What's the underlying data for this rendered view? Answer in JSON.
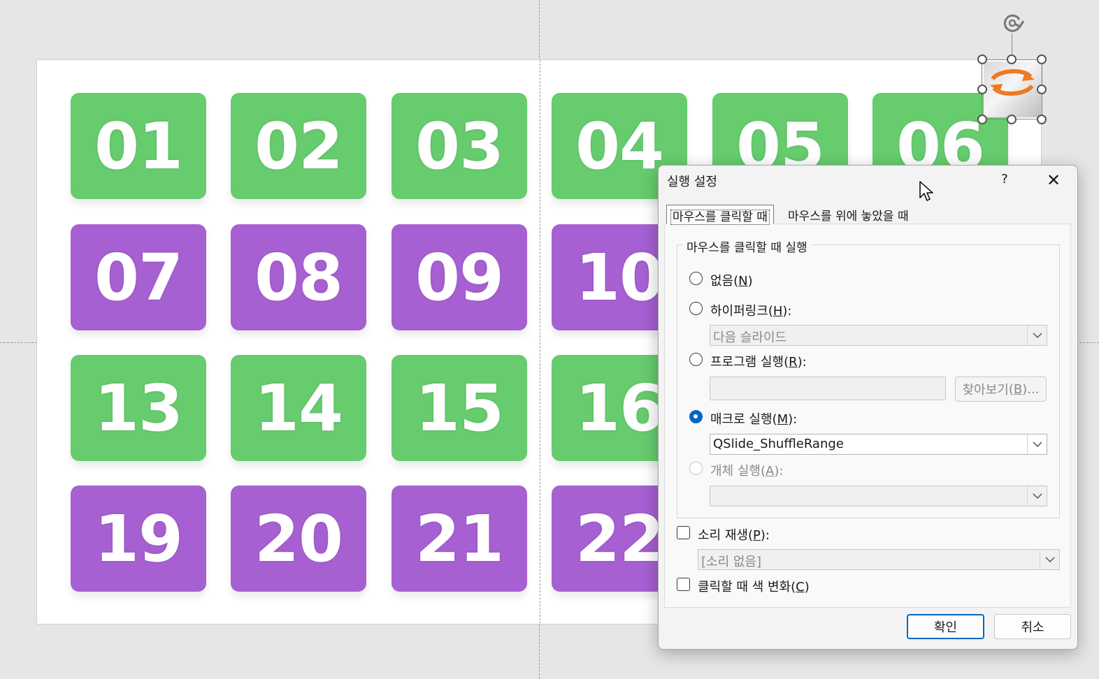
{
  "tiles": [
    {
      "label": "01",
      "color": "green"
    },
    {
      "label": "02",
      "color": "green"
    },
    {
      "label": "03",
      "color": "green"
    },
    {
      "label": "04",
      "color": "green"
    },
    {
      "label": "05",
      "color": "green"
    },
    {
      "label": "06",
      "color": "green"
    },
    {
      "label": "07",
      "color": "purple"
    },
    {
      "label": "08",
      "color": "purple"
    },
    {
      "label": "09",
      "color": "purple"
    },
    {
      "label": "10",
      "color": "purple"
    },
    {
      "label": "13",
      "color": "green"
    },
    {
      "label": "14",
      "color": "green"
    },
    {
      "label": "15",
      "color": "green"
    },
    {
      "label": "16",
      "color": "green"
    },
    {
      "label": "19",
      "color": "purple"
    },
    {
      "label": "20",
      "color": "purple"
    },
    {
      "label": "21",
      "color": "purple"
    },
    {
      "label": "22",
      "color": "purple"
    }
  ],
  "colors": {
    "green": "#66cc6e",
    "purple": "#a660d2",
    "shuffle_icon": "#ee7a22",
    "accent": "#0067c0"
  },
  "shuffle_object": {
    "icon": "shuffle-arrows-icon",
    "rotate_icon": "rotate-handle-icon"
  },
  "dialog": {
    "title": "실행 설정",
    "help": "?",
    "close_icon": "close-icon",
    "tabs": [
      {
        "label": "마우스를 클릭할 때",
        "selected": true
      },
      {
        "label": "마우스를 위에 놓았을 때",
        "selected": false
      }
    ],
    "group_title": "마우스를 클릭할 때 실행",
    "options": {
      "none": {
        "text": "없음",
        "key": "N",
        "checked": false
      },
      "hyperlink": {
        "text": "하이퍼링크",
        "key": "H",
        "checked": false,
        "value": "다음 슬라이드"
      },
      "program": {
        "text": "프로그램 실행",
        "key": "R",
        "checked": false,
        "value": "",
        "browse_text": "찾아보기",
        "browse_key": "B"
      },
      "macro": {
        "text": "매크로 실행",
        "key": "M",
        "checked": true,
        "value": "QSlide_ShuffleRange"
      },
      "object": {
        "text": "개체 실행",
        "key": "A",
        "checked": false,
        "disabled": true,
        "value": ""
      }
    },
    "sound": {
      "text": "소리 재생",
      "key": "P",
      "checked": false,
      "value": "[소리 없음]"
    },
    "highlight": {
      "text": "클릭할 때 색 변화",
      "key": "C",
      "checked": false
    },
    "ok_label": "확인",
    "cancel_label": "취소"
  }
}
